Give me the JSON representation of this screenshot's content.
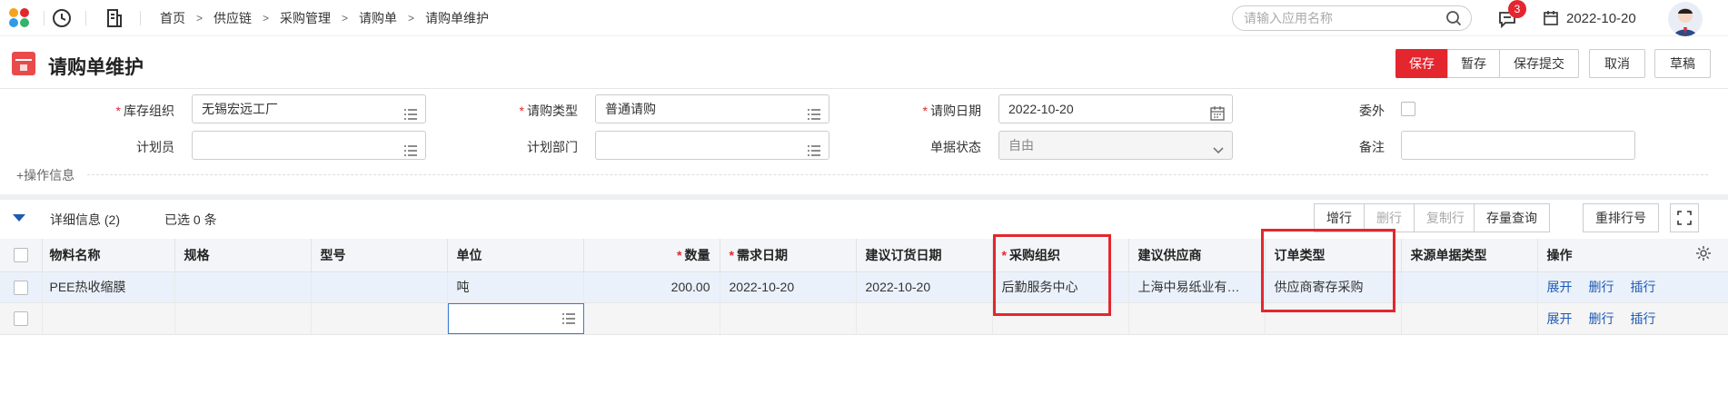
{
  "topbar": {
    "breadcrumb": [
      "首页",
      "供应链",
      "采购管理",
      "请购单",
      "请购单维护"
    ],
    "search_placeholder": "请输入应用名称",
    "notification_count": "3",
    "date": "2022-10-20"
  },
  "title": "请购单维护",
  "toolbar": {
    "save": "保存",
    "temp_save": "暂存",
    "save_submit": "保存提交",
    "cancel": "取消",
    "draft": "草稿"
  },
  "form": {
    "inv_org_label": "库存组织",
    "inv_org_value": "无锡宏远工厂",
    "req_type_label": "请购类型",
    "req_type_value": "普通请购",
    "req_date_label": "请购日期",
    "req_date_value": "2022-10-20",
    "outsource_label": "委外",
    "planner_label": "计划员",
    "plan_dept_label": "计划部门",
    "status_label": "单据状态",
    "status_value": "自由",
    "remark_label": "备注",
    "ops_info": "+操作信息"
  },
  "grid_bar": {
    "detail": "详细信息 (2)",
    "selected": "已选 0 条",
    "add_row": "增行",
    "del_row": "删行",
    "copy_row": "复制行",
    "stock_query": "存量查询",
    "renumber": "重排行号"
  },
  "table": {
    "columns": [
      "物料名称",
      "规格",
      "型号",
      "单位",
      "数量",
      "需求日期",
      "建议订货日期",
      "采购组织",
      "建议供应商",
      "订单类型",
      "来源单据类型",
      "操作"
    ],
    "rows": [
      [
        "PEE热收缩膜",
        "",
        "",
        "吨",
        "200.00",
        "2022-10-20",
        "2022-10-20",
        "后勤服务中心",
        "上海中易纸业有…",
        "供应商寄存采购",
        ""
      ],
      [
        "",
        "",
        "",
        "",
        "",
        "",
        "",
        "",
        "",
        "",
        ""
      ]
    ],
    "row_actions": [
      "展开",
      "删行",
      "插行"
    ]
  },
  "colors": {
    "accent": "#e4262f",
    "link": "#1e5ab3"
  }
}
